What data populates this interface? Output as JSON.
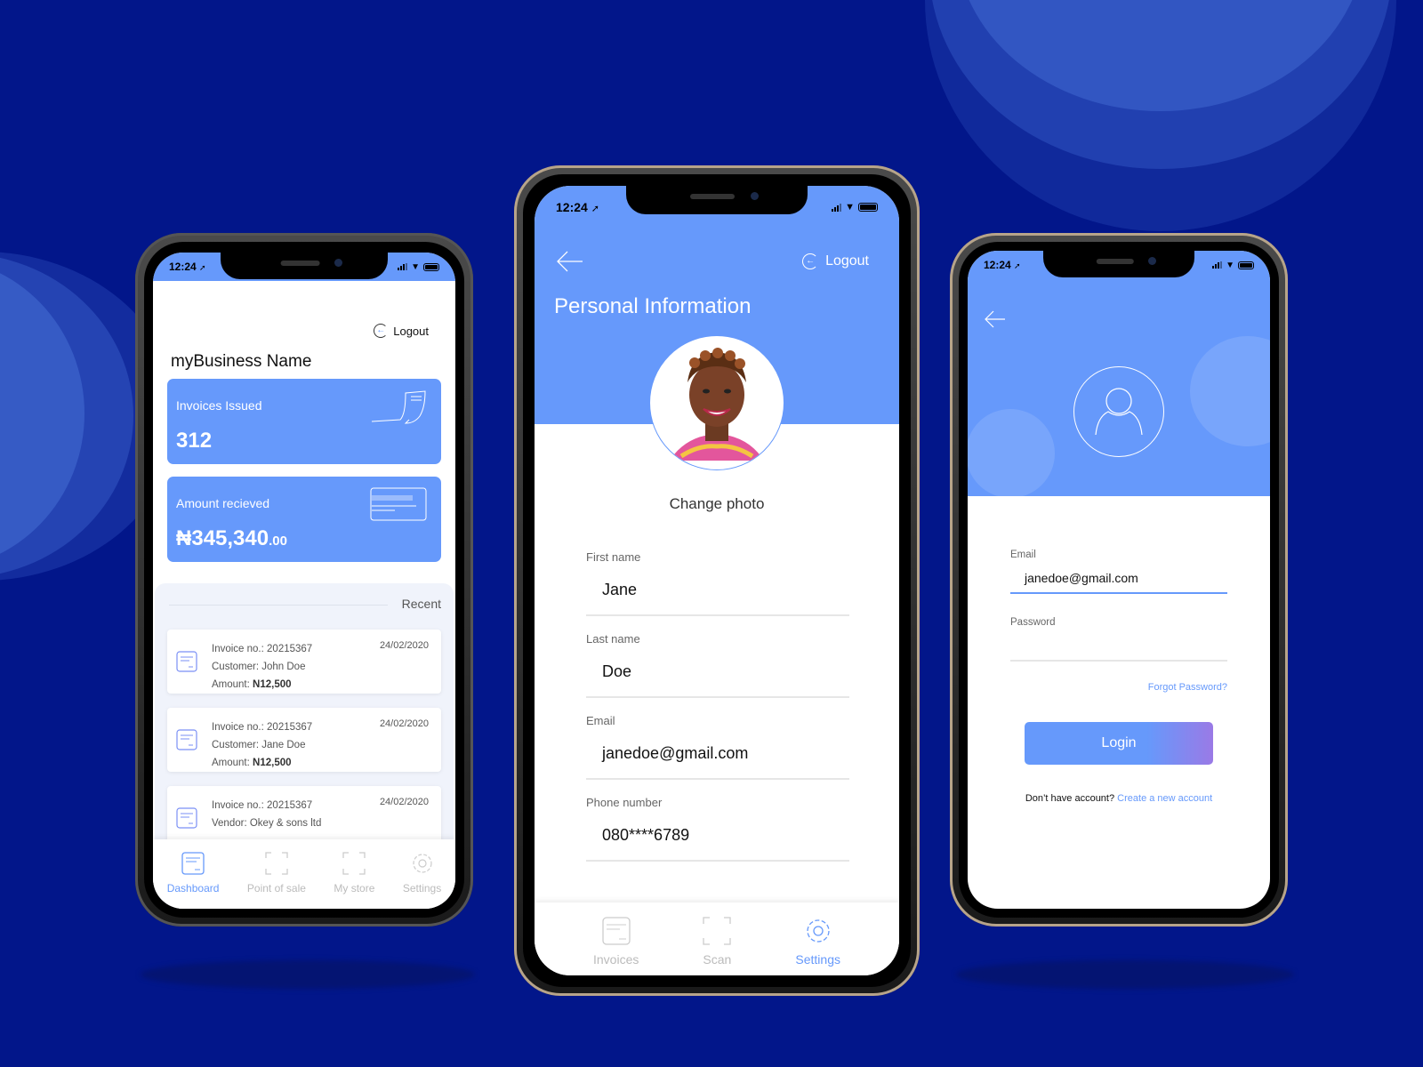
{
  "colors": {
    "background": "#02168a",
    "accent": "#6699fb",
    "accent_gradient_end": "#9a7ae6"
  },
  "statusbar": {
    "time": "12:24",
    "location_icon": "location-arrow-icon"
  },
  "dashboard": {
    "logout_label": "Logout",
    "business_name": "myBusiness Name",
    "invoices_card": {
      "label": "Invoices Issued",
      "value": "312",
      "icon": "invoice-paper-icon"
    },
    "amount_card": {
      "label": "Amount recieved",
      "currency": "₦",
      "value_main": "345,340",
      "value_decimals": ".00",
      "icon": "card-icon"
    },
    "recent_label": "Recent",
    "recent_items": [
      {
        "invoice_label": "Invoice no.:",
        "invoice_no": "20215367",
        "party_label": "Customer:",
        "party": "John Doe",
        "amount_label": "Amount:",
        "amount": "N12,500",
        "date": "24/02/2020"
      },
      {
        "invoice_label": "Invoice no.:",
        "invoice_no": "20215367",
        "party_label": "Customer:",
        "party": "Jane Doe",
        "amount_label": "Amount:",
        "amount": "N12,500",
        "date": "24/02/2020"
      },
      {
        "invoice_label": "Invoice no.:",
        "invoice_no": "20215367",
        "party_label": "Vendor:",
        "party": "Okey & sons ltd",
        "amount_label": "",
        "amount": "",
        "date": "24/02/2020"
      }
    ],
    "tabs": [
      {
        "label": "Dashboard",
        "icon": "document-icon",
        "active": true
      },
      {
        "label": "Point of sale",
        "icon": "scan-frame-icon",
        "active": false
      },
      {
        "label": "My store",
        "icon": "scan-frame-icon",
        "active": false
      },
      {
        "label": "Settings",
        "icon": "gear-icon",
        "active": false
      }
    ]
  },
  "profile": {
    "back_icon": "arrow-left-icon",
    "logout_label": "Logout",
    "title": "Personal Information",
    "change_photo_label": "Change photo",
    "fields": [
      {
        "label": "First name",
        "value": "Jane"
      },
      {
        "label": "Last name",
        "value": "Doe"
      },
      {
        "label": "Email",
        "value": "janedoe@gmail.com"
      },
      {
        "label": "Phone number",
        "value": "080****6789"
      }
    ],
    "tabs": [
      {
        "label": "Invoices",
        "icon": "document-icon",
        "active": false
      },
      {
        "label": "Scan",
        "icon": "scan-frame-icon",
        "active": false
      },
      {
        "label": "Settings",
        "icon": "gear-icon",
        "active": true
      }
    ]
  },
  "login": {
    "back_icon": "arrow-left-icon",
    "email_label": "Email",
    "email_value": "janedoe@gmail.com",
    "password_label": "Password",
    "password_value": "",
    "forgot_label": "Forgot Password?",
    "login_button": "Login",
    "no_account_text": "Don’t have account?",
    "create_account_link": "Create a new account"
  }
}
